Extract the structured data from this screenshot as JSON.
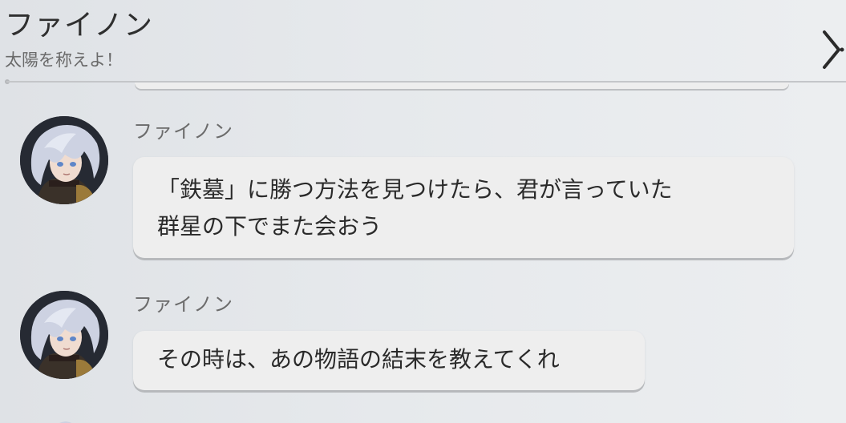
{
  "header": {
    "contact_name": "ファイノン",
    "status_message": "太陽を称えよ！",
    "close_icon": "chevron-right-icon"
  },
  "messages": [
    {
      "sender": "ファイノン",
      "avatar_icon": "character-avatar-icon",
      "lines": [
        "「鉄墓」に勝つ方法を見つけたら、君が言っていた",
        "群星の下でまた会おう"
      ]
    },
    {
      "sender": "ファイノン",
      "avatar_icon": "character-avatar-icon",
      "lines": [
        "その時は、あの物語の結末を教えてくれ"
      ]
    }
  ],
  "colors": {
    "background": "#e6e9ec",
    "bubble": "#eeeeee",
    "text": "#2a2a2a",
    "muted_text": "#6b6b6b",
    "avatar_bg": "#252830"
  }
}
